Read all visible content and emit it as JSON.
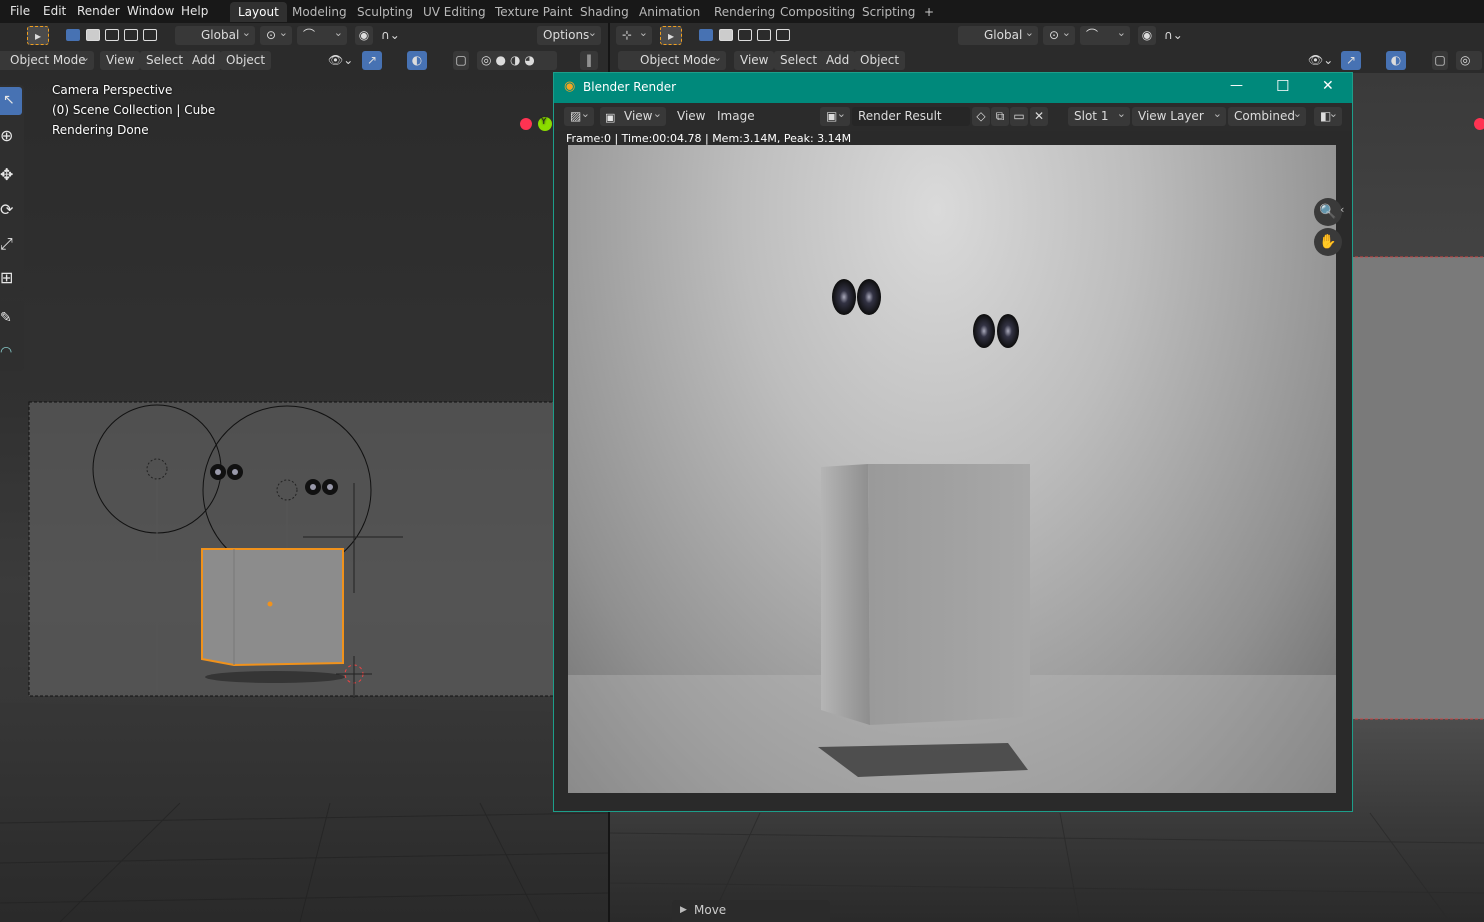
{
  "topbar": {
    "menus": [
      "File",
      "Edit",
      "Render",
      "Window",
      "Help"
    ],
    "workspaces": [
      "Layout",
      "Modeling",
      "Sculpting",
      "UV Editing",
      "Texture Paint",
      "Shading",
      "Animation",
      "Rendering",
      "Compositing",
      "Scripting"
    ],
    "add_workspace": "+"
  },
  "tool_header_left": {
    "orientation": "Global",
    "options": "Options"
  },
  "tool_header_right": {
    "orientation": "Global"
  },
  "viewport_left": {
    "mode": "Object Mode",
    "menus": [
      "View",
      "Select",
      "Add",
      "Object"
    ],
    "overlay": {
      "line1": "Camera Perspective",
      "line2": "(0) Scene Collection | Cube",
      "line3": "Rendering Done"
    },
    "gizmo_y": "Y"
  },
  "viewport_right": {
    "mode": "Object Mode",
    "menus": [
      "View",
      "Select",
      "Add",
      "Object"
    ]
  },
  "render_window": {
    "title": "Blender Render",
    "minimize": "—",
    "maximize": "☐",
    "close": "✕",
    "header": {
      "view_dropdown": "View",
      "view_menu": "View",
      "image_menu": "Image",
      "image_name": "Render Result",
      "slot": "Slot 1",
      "view_layer": "View Layer",
      "pass": "Combined"
    },
    "stats": "Frame:0 | Time:00:04.78 | Mem:3.14M, Peak: 3.14M"
  },
  "last_operator": {
    "label": "Move"
  },
  "colors": {
    "accent": "#4772b3",
    "title_bar": "#00897b",
    "selection_outline": "#f0921c"
  }
}
